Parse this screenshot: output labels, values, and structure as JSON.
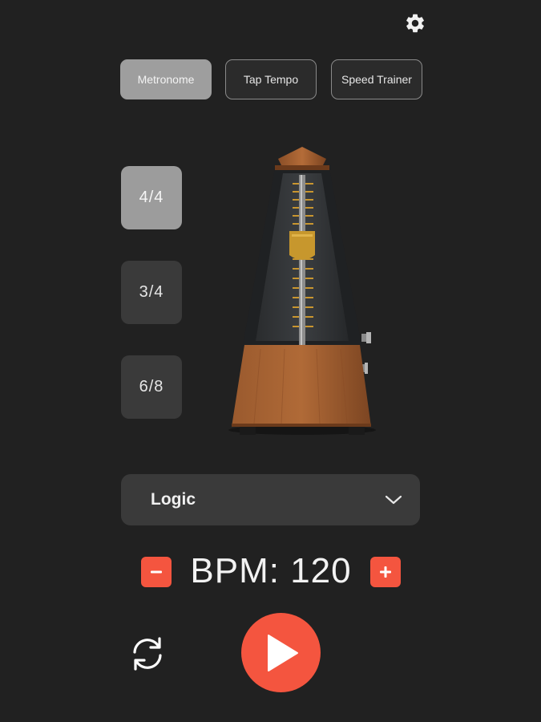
{
  "header": {
    "settings_icon": "gear-icon"
  },
  "mode_tabs": [
    {
      "label": "Metronome",
      "active": true
    },
    {
      "label": "Tap Tempo",
      "active": false
    },
    {
      "label": "Speed Trainer",
      "active": false
    }
  ],
  "time_signatures": [
    {
      "label": "4/4",
      "active": true
    },
    {
      "label": "3/4",
      "active": false
    },
    {
      "label": "6/8",
      "active": false
    }
  ],
  "sound": {
    "selected": "Logic",
    "icon": "chevron-down-icon"
  },
  "bpm": {
    "label": "BPM: 120",
    "decrement_icon": "minus-icon",
    "increment_icon": "plus-icon"
  },
  "controls": {
    "loop_icon": "refresh-icon",
    "play_icon": "play-icon"
  },
  "colors": {
    "accent": "#f4553f",
    "background": "#212121",
    "active_tab": "#9e9e9e",
    "inactive_tab": "#3a3a3a"
  }
}
